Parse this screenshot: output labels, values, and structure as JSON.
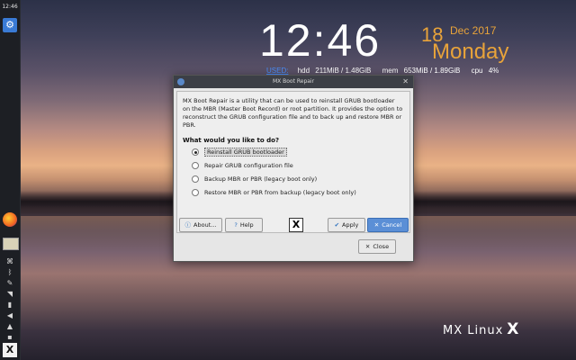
{
  "panel": {
    "clock": "12:46",
    "menu_icon": "gear-icon",
    "mx_icon": "X"
  },
  "conky": {
    "time": "12:46",
    "day": "18",
    "month_year": "Dec 2017",
    "weekday": "Monday",
    "used_label": "USED:",
    "hdd_label": "hdd",
    "hdd_value": "211MiB / 1.48GiB",
    "mem_label": "mem",
    "mem_value": "653MiB / 1.89GiB",
    "cpu_label": "cpu",
    "cpu_value": "4%"
  },
  "dialog": {
    "title": "MX Boot Repair",
    "description": "MX Boot Repair is a utility that can be used to reinstall GRUB bootloader on the MBR (Master Boot Record) or root partition. It provides the option to reconstruct the GRUB configuration file and to back up and restore MBR or PBR.",
    "question": "What would you like to do?",
    "options": [
      {
        "label": "Reinstall GRUB bootloader",
        "selected": true
      },
      {
        "label": "Repair GRUB configuration file",
        "selected": false
      },
      {
        "label": "Backup MBR or PBR (legacy boot only)",
        "selected": false
      },
      {
        "label": "Restore MBR or PBR from backup (legacy boot only)",
        "selected": false
      }
    ],
    "buttons": {
      "about": "About...",
      "help": "Help",
      "apply": "Apply",
      "cancel": "Cancel",
      "close": "Close"
    },
    "center_logo": "X"
  },
  "desktop": {
    "brand": "MX Linux",
    "brand_mark": "X"
  }
}
